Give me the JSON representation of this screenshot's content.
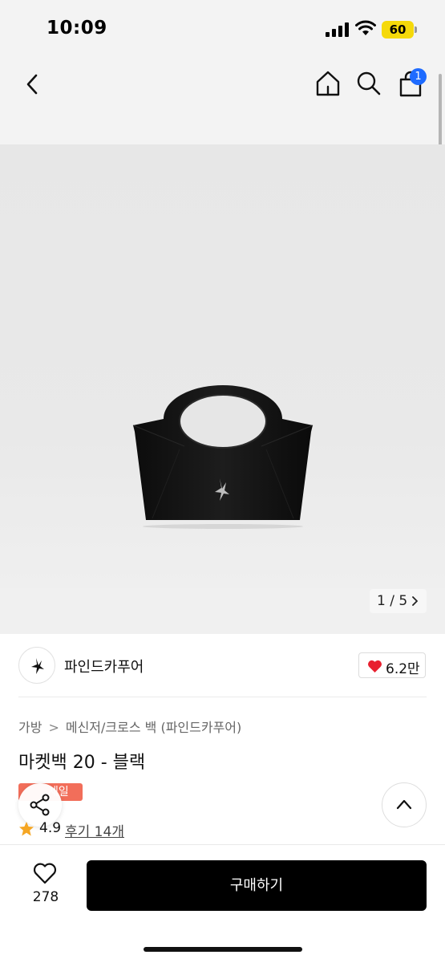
{
  "status_bar": {
    "time": "10:09",
    "battery": "60",
    "icons": [
      "signal-icon",
      "wifi-icon",
      "battery-icon"
    ]
  },
  "nav": {
    "back_icon": "chevron-left-icon",
    "home_icon": "home-icon",
    "search_icon": "search-icon",
    "cart_icon": "shopping-bag-icon",
    "cart_badge": "1",
    "badge_color": "#1e6bff"
  },
  "gallery": {
    "counter": "1 / 5",
    "current_index": 1,
    "total": 5
  },
  "brand": {
    "name": "파인드카푸어",
    "likes": "6.2만",
    "heart_color": "#e8202f"
  },
  "breadcrumb": {
    "items": [
      "가방",
      "메신저/크로스 백 (파인드카푸어)"
    ],
    "separator": ">"
  },
  "product": {
    "title": "마켓백 20 - 블랙",
    "sale_badge": "세일",
    "sale_color": "#f26e5a",
    "rating": "4.9",
    "reviews": "후기 14개",
    "star_color": "#f5a623"
  },
  "bottom": {
    "wishlist_count": "278",
    "buy_label": "구매하기"
  }
}
